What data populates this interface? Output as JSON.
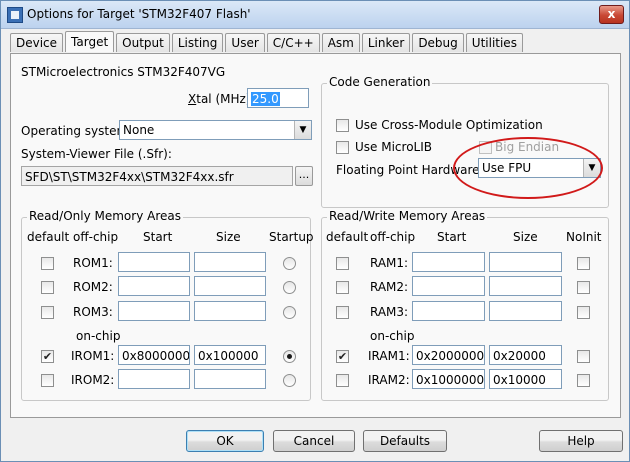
{
  "window": {
    "title": "Options for Target 'STM32F407 Flash'",
    "close_glyph": "x"
  },
  "tabs": [
    "Device",
    "Target",
    "Output",
    "Listing",
    "User",
    "C/C++",
    "Asm",
    "Linker",
    "Debug",
    "Utilities"
  ],
  "device_name": "STMicroelectronics STM32F407VG",
  "xtal": {
    "label_pre": "",
    "label_u": "X",
    "label_post": "tal (MHz):",
    "value": "25.0"
  },
  "os": {
    "label": "Operating system:",
    "value": "None"
  },
  "svd": {
    "label": "System-Viewer File (.Sfr):",
    "value": "SFD\\ST\\STM32F4xx\\STM32F4xx.sfr",
    "browse": "..."
  },
  "codegen": {
    "title": "Code Generation",
    "cross_module": "Use Cross-Module Optimization",
    "microlib": "Use MicroLIB",
    "big_endian": "Big Endian",
    "fpu_label": "Floating Point Hardware:",
    "fpu_value": "Use FPU"
  },
  "rom": {
    "title": "Read/Only Memory Areas",
    "headers": {
      "default": "default",
      "offchip": "off-chip",
      "start": "Start",
      "size": "Size",
      "startup": "Startup"
    },
    "onchip_label": "on-chip",
    "rows": [
      {
        "label": "ROM1:",
        "start": "",
        "size": "",
        "default": false,
        "startup": false
      },
      {
        "label": "ROM2:",
        "start": "",
        "size": "",
        "default": false,
        "startup": false
      },
      {
        "label": "ROM3:",
        "start": "",
        "size": "",
        "default": false,
        "startup": false
      },
      {
        "label": "IROM1:",
        "start": "0x8000000",
        "size": "0x100000",
        "default": true,
        "startup": true
      },
      {
        "label": "IROM2:",
        "start": "",
        "size": "",
        "default": false,
        "startup": false
      }
    ]
  },
  "ram": {
    "title": "Read/Write Memory Areas",
    "headers": {
      "default": "default",
      "offchip": "off-chip",
      "start": "Start",
      "size": "Size",
      "noinit": "NoInit"
    },
    "onchip_label": "on-chip",
    "rows": [
      {
        "label": "RAM1:",
        "start": "",
        "size": "",
        "default": false,
        "noinit": false
      },
      {
        "label": "RAM2:",
        "start": "",
        "size": "",
        "default": false,
        "noinit": false
      },
      {
        "label": "RAM3:",
        "start": "",
        "size": "",
        "default": false,
        "noinit": false
      },
      {
        "label": "IRAM1:",
        "start": "0x20000000",
        "size": "0x20000",
        "default": true,
        "noinit": false
      },
      {
        "label": "IRAM2:",
        "start": "0x10000000",
        "size": "0x10000",
        "default": false,
        "noinit": false
      }
    ]
  },
  "buttons": {
    "ok": "OK",
    "cancel": "Cancel",
    "defaults": "Defaults",
    "help": "Help"
  },
  "highlight_color": "#d11a1a"
}
